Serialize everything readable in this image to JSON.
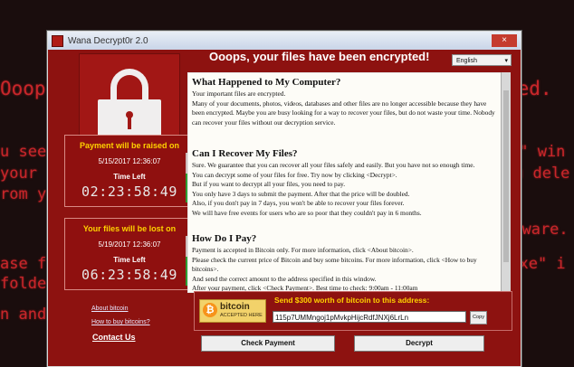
{
  "background": {
    "lines": [
      "Ooop",
      "ted.",
      "u see",
      "r\" win",
      "your",
      "u dele",
      "rom yo",
      "ftware.",
      "ase fi",
      ".exe\" i",
      " folde",
      "n and fo"
    ]
  },
  "window": {
    "title": "Wana Decrypt0r 2.0",
    "main_title": "Ooops, your files have been encrypted!",
    "language": "English",
    "timers": [
      {
        "title": "Payment will be raised on",
        "date": "5/15/2017 12:36:07",
        "time_left_label": "Time Left",
        "countdown": "02:23:58:49",
        "fill": 0.58
      },
      {
        "title": "Your files will be lost on",
        "date": "5/19/2017 12:36:07",
        "time_left_label": "Time Left",
        "countdown": "06:23:58:49",
        "fill": 0.58
      }
    ],
    "links": {
      "about_bitcoin": "About bitcoin",
      "how_to_buy": "How to buy bitcoins?",
      "contact": "Contact Us"
    },
    "sections": [
      {
        "title": "What Happened to My Computer?",
        "paragraphs": [
          "Your important files are encrypted.",
          "Many of your documents, photos, videos, databases and other files are no longer accessible because they have been encrypted. Maybe you are busy looking for a way to recover your files, but do not waste your time. Nobody can recover your files without our decryption service."
        ]
      },
      {
        "title": "Can I Recover My Files?",
        "paragraphs": [
          "Sure. We guarantee that you can recover all your files safely and easily. But you have not so enough time.",
          "You can decrypt some of your files for free. Try now by clicking <Decrypt>.",
          "But if you want to decrypt all your files, you need to pay.",
          "You only have 3 days to submit the payment. After that the price will be doubled.",
          "Also, if you don't pay in 7 days, you won't be able to recover your files forever.",
          "We will have free events for users who are so poor that they couldn't pay in 6 months."
        ]
      },
      {
        "title": "How Do I Pay?",
        "paragraphs": [
          "Payment is accepted in Bitcoin only. For more information, click <About bitcoin>.",
          "Please check the current price of Bitcoin and buy some bitcoins. For more information, click <How to buy bitcoins>.",
          "And send the correct amount to the address specified in this window.",
          "After your payment, click <Check Payment>. Best time to check: 9:00am - 11:00am"
        ]
      }
    ],
    "bitcoin": {
      "logo_text": "bitcoin",
      "accepted": "ACCEPTED HERE",
      "send_text": "Send $300 worth of bitcoin to this address:",
      "address": "115p7UMMngoj1pMvkpHijcRdfJNXj6LrLn",
      "copy_label": "Copy"
    },
    "buttons": {
      "check_payment": "Check Payment",
      "decrypt": "Decrypt"
    },
    "colors": {
      "accent_red": "#8d1210",
      "warning_yellow": "#ffd200",
      "bar_green": "#2f9e35",
      "bar_red": "#d52b1e"
    }
  }
}
